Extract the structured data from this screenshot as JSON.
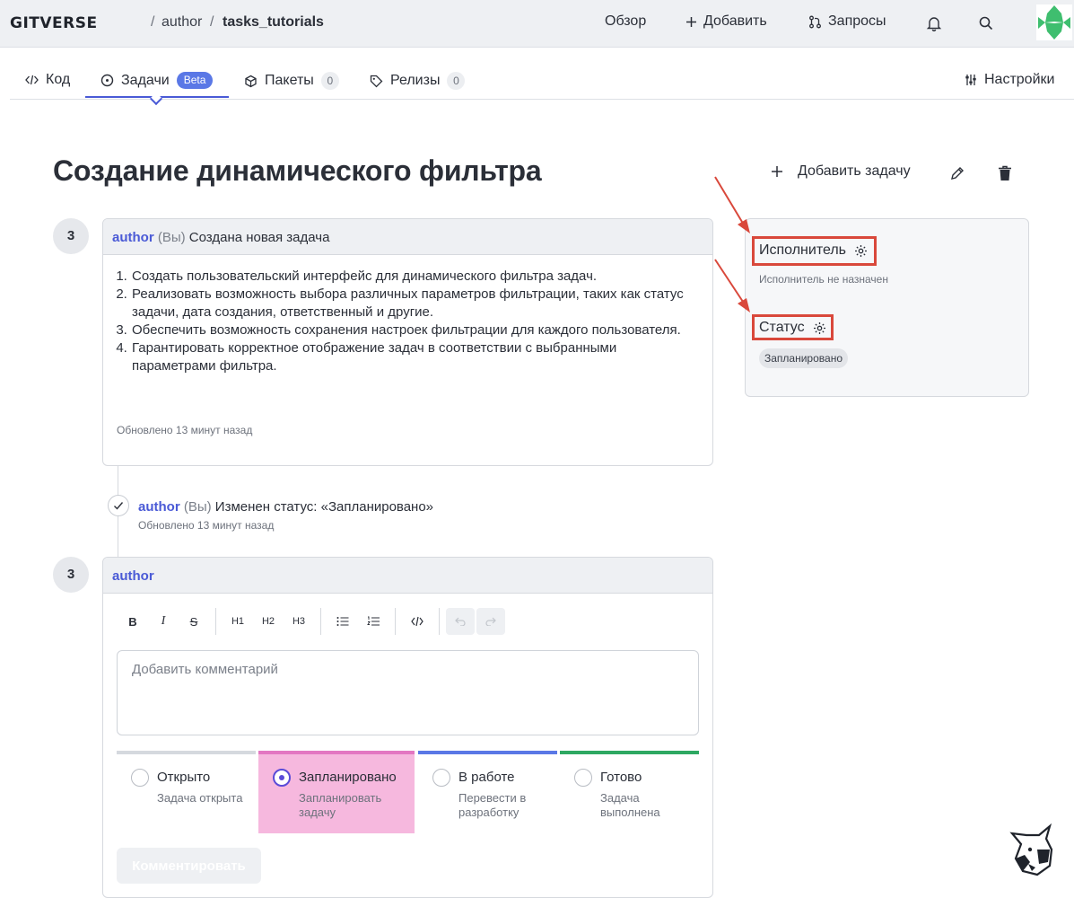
{
  "header": {
    "logo": "GITVERSE",
    "breadcrumb": {
      "owner": "author",
      "separator": "/",
      "repo": "tasks_tutorials"
    },
    "nav": {
      "overview": "Обзор",
      "add": "Добавить",
      "requests": "Запросы"
    }
  },
  "tabs": [
    {
      "label": "Код"
    },
    {
      "label": "Задачи",
      "badge": "Beta",
      "active": true
    },
    {
      "label": "Пакеты",
      "count": "0"
    },
    {
      "label": "Релизы",
      "count": "0"
    },
    {
      "label": "Настройки"
    }
  ],
  "issue": {
    "title": "Создание динамического фильтра",
    "add_task": "Добавить задачу",
    "first_comment": {
      "avatar": "3",
      "author": "author",
      "you": "(Вы)",
      "action": "Создана новая задача",
      "items": [
        "Создать пользовательский интерфейс для динамического фильтра задач.",
        "Реализовать возможность выбора различных параметров фильтрации, таких как статус задачи, дата создания, ответственный и другие.",
        "Обеспечить возможность сохранения настроек фильтрации для каждого пользователя.",
        "Гарантировать корректное отображение задач в соответствии с выбранными параметрами фильтра."
      ],
      "updated": "Обновлено 13 минут назад"
    },
    "event": {
      "author": "author",
      "you": "(Вы)",
      "text": "Изменен статус: «Запланировано»",
      "updated": "Обновлено 13 минут назад"
    }
  },
  "editor": {
    "avatar": "3",
    "author": "author",
    "toolbar": {
      "bold": "B",
      "italic": "I",
      "strike": "S",
      "h1": "H1",
      "h2": "H2",
      "h3": "H3"
    },
    "placeholder": "Добавить комментарий",
    "statuses": [
      {
        "label": "Открыто",
        "sub": "Задача открыта",
        "color": "#d5d9de",
        "selected": false
      },
      {
        "label": "Запланировано",
        "sub": "Запланировать задачу",
        "color": "#e377c2",
        "selected": true
      },
      {
        "label": "В работе",
        "sub": "Перевести в разработку",
        "color": "#5a78e6",
        "selected": false
      },
      {
        "label": "Готово",
        "sub": "Задача выполнена",
        "color": "#2ea862",
        "selected": false
      }
    ],
    "submit": "Комментировать"
  },
  "sidebar": {
    "assignee_title": "Исполнитель",
    "assignee_value": "Исполнитель не назначен",
    "status_title": "Статус",
    "status_value": "Запланировано"
  },
  "colors": {
    "accent": "#4a5ad6",
    "annotation": "#d9483b",
    "selected_status_bg": "#f6b8de"
  }
}
